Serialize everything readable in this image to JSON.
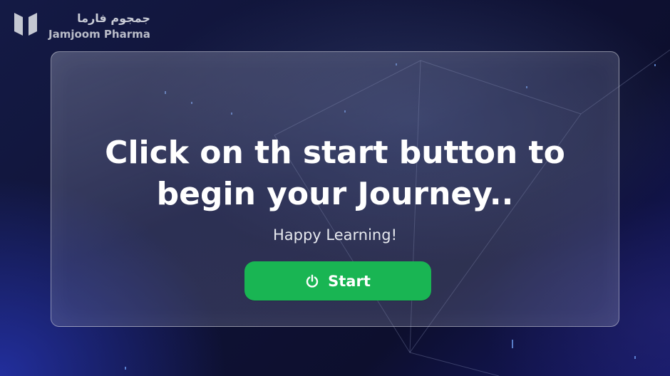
{
  "brand": {
    "name_arabic": "جمجوم فارما",
    "name_english": "Jamjoom Pharma"
  },
  "card": {
    "headline_line1": "Click on th start button to",
    "headline_line2": "begin your Journey..",
    "subtitle": "Happy Learning!"
  },
  "start_button": {
    "label": "Start",
    "icon": "power-icon",
    "color": "#19b553"
  },
  "colors": {
    "background_dark": "#0f1235",
    "background_accent": "#1f2fb8",
    "text_primary": "#ffffff"
  }
}
